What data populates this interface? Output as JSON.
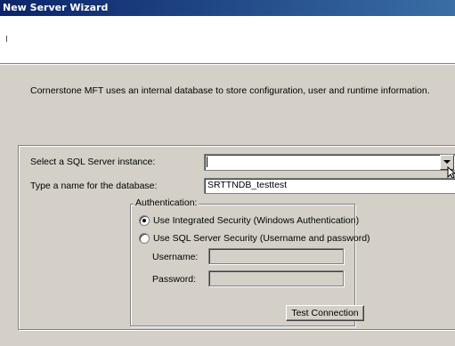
{
  "window": {
    "title": "New Server Wizard"
  },
  "intro_text": "Cornerstone MFT uses an internal database to store configuration, user and runtime information.",
  "form": {
    "instance_label": "Select a SQL Server instance:",
    "instance_value": "",
    "db_label": "Type a name for the database:",
    "db_value": "SRTTNDB_testtest",
    "auth": {
      "legend": "Authentication:",
      "integrated_label": "Use Integrated Security (Windows Authentication)",
      "sql_label": "Use SQL Server Security (Username and password)",
      "selected": "integrated",
      "username_label": "Username:",
      "username_value": "",
      "password_label": "Password:",
      "password_value": ""
    },
    "test_button": "Test Connection"
  },
  "icons": [
    "dropdown-arrow-icon",
    "mouse-cursor-icon"
  ],
  "colors": {
    "title_start": "#0a246a",
    "title_end": "#3a6ea5",
    "dialog": "#d4d0c8"
  }
}
